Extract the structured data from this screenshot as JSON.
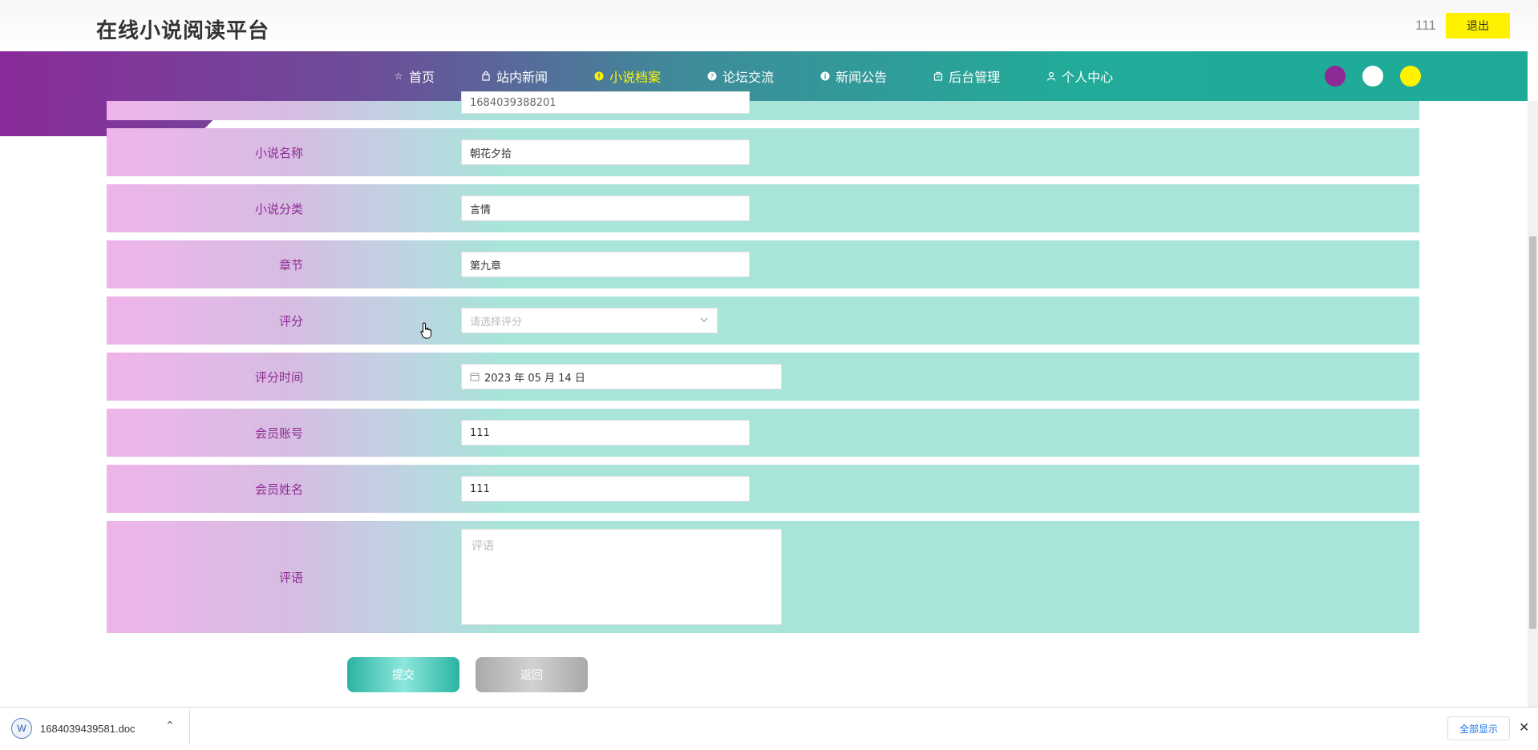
{
  "header": {
    "site_title": "在线小说阅读平台",
    "user_name": "111",
    "logout_label": "退出"
  },
  "nav": {
    "items": [
      {
        "label": "首页",
        "icon": "star-icon"
      },
      {
        "label": "站内新闻",
        "icon": "bag-icon"
      },
      {
        "label": "小说档案",
        "icon": "info-circle-icon",
        "active": true
      },
      {
        "label": "论坛交流",
        "icon": "question-circle-icon"
      },
      {
        "label": "新闻公告",
        "icon": "info-circle-icon"
      },
      {
        "label": "后台管理",
        "icon": "briefcase-icon"
      },
      {
        "label": "个人中心",
        "icon": "user-icon"
      }
    ],
    "theme_colors": [
      "#8e2a95",
      "#ffffff",
      "#fff200"
    ]
  },
  "form": {
    "partial_field_value": "1684039388201",
    "novel_name_label": "小说名称",
    "novel_name_value": "朝花夕拾",
    "category_label": "小说分类",
    "category_value": "言情",
    "chapter_label": "章节",
    "chapter_value": "第九章",
    "rating_label": "评分",
    "rating_placeholder": "请选择评分",
    "rating_time_label": "评分时间",
    "rating_time_value": "2023 年 05 月 14 日",
    "member_account_label": "会员账号",
    "member_account_value": "111",
    "member_name_label": "会员姓名",
    "member_name_value": "111",
    "comment_label": "评语",
    "comment_placeholder": "评语",
    "submit_label": "提交",
    "back_label": "返回"
  },
  "download_bar": {
    "file_name": "1684039439581.doc",
    "show_all_label": "全部显示"
  },
  "colors": {
    "accent_purple": "#8e2a95",
    "accent_teal": "#22ab98",
    "accent_yellow": "#fff200"
  }
}
